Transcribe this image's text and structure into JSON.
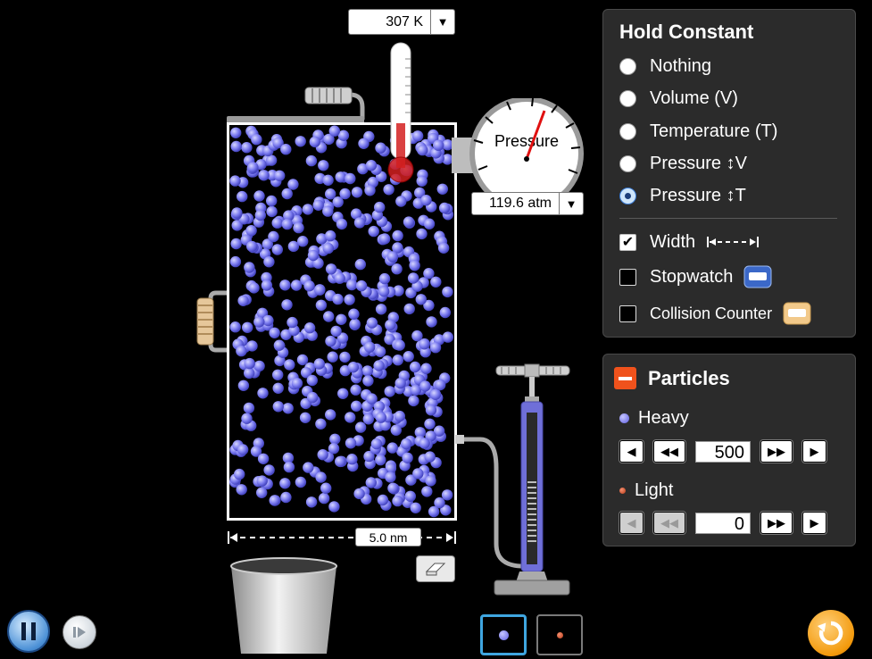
{
  "temperature": {
    "value": "307 K",
    "arrow": "▼"
  },
  "pressure": {
    "gauge_label": "Pressure",
    "value": "119.6 atm",
    "arrow": "▼"
  },
  "container": {
    "width_label": "5.0 nm",
    "heavy_count": 500,
    "light_count": 0
  },
  "hold_constant": {
    "title": "Hold Constant",
    "options": [
      {
        "label": "Nothing",
        "selected": false
      },
      {
        "label": "Volume (V)",
        "selected": false
      },
      {
        "label": "Temperature (T)",
        "selected": false
      },
      {
        "label": "Pressure ↕V",
        "selected": false
      },
      {
        "label": "Pressure ↕T",
        "selected": true
      }
    ],
    "checkboxes": [
      {
        "label": "Width",
        "checked": true,
        "icon": "width-arrows-icon"
      },
      {
        "label": "Stopwatch",
        "checked": false,
        "icon": "stopwatch-icon"
      },
      {
        "label": "Collision Counter",
        "checked": false,
        "icon": "collision-counter-icon"
      }
    ]
  },
  "particles": {
    "title": "Particles",
    "collapse_symbol": "−",
    "heavy": {
      "label": "Heavy",
      "value": "500",
      "color": "#7b7bef"
    },
    "light": {
      "label": "Light",
      "value": "0",
      "color": "#e8532a"
    }
  },
  "colors": {
    "panel_bg": "#2b2b2b",
    "heavy_particle": "#7b7bef",
    "light_particle": "#e8532a",
    "reset": "#f39a0d",
    "pause": "#4b90d6",
    "pump": "#6f6fd8"
  }
}
